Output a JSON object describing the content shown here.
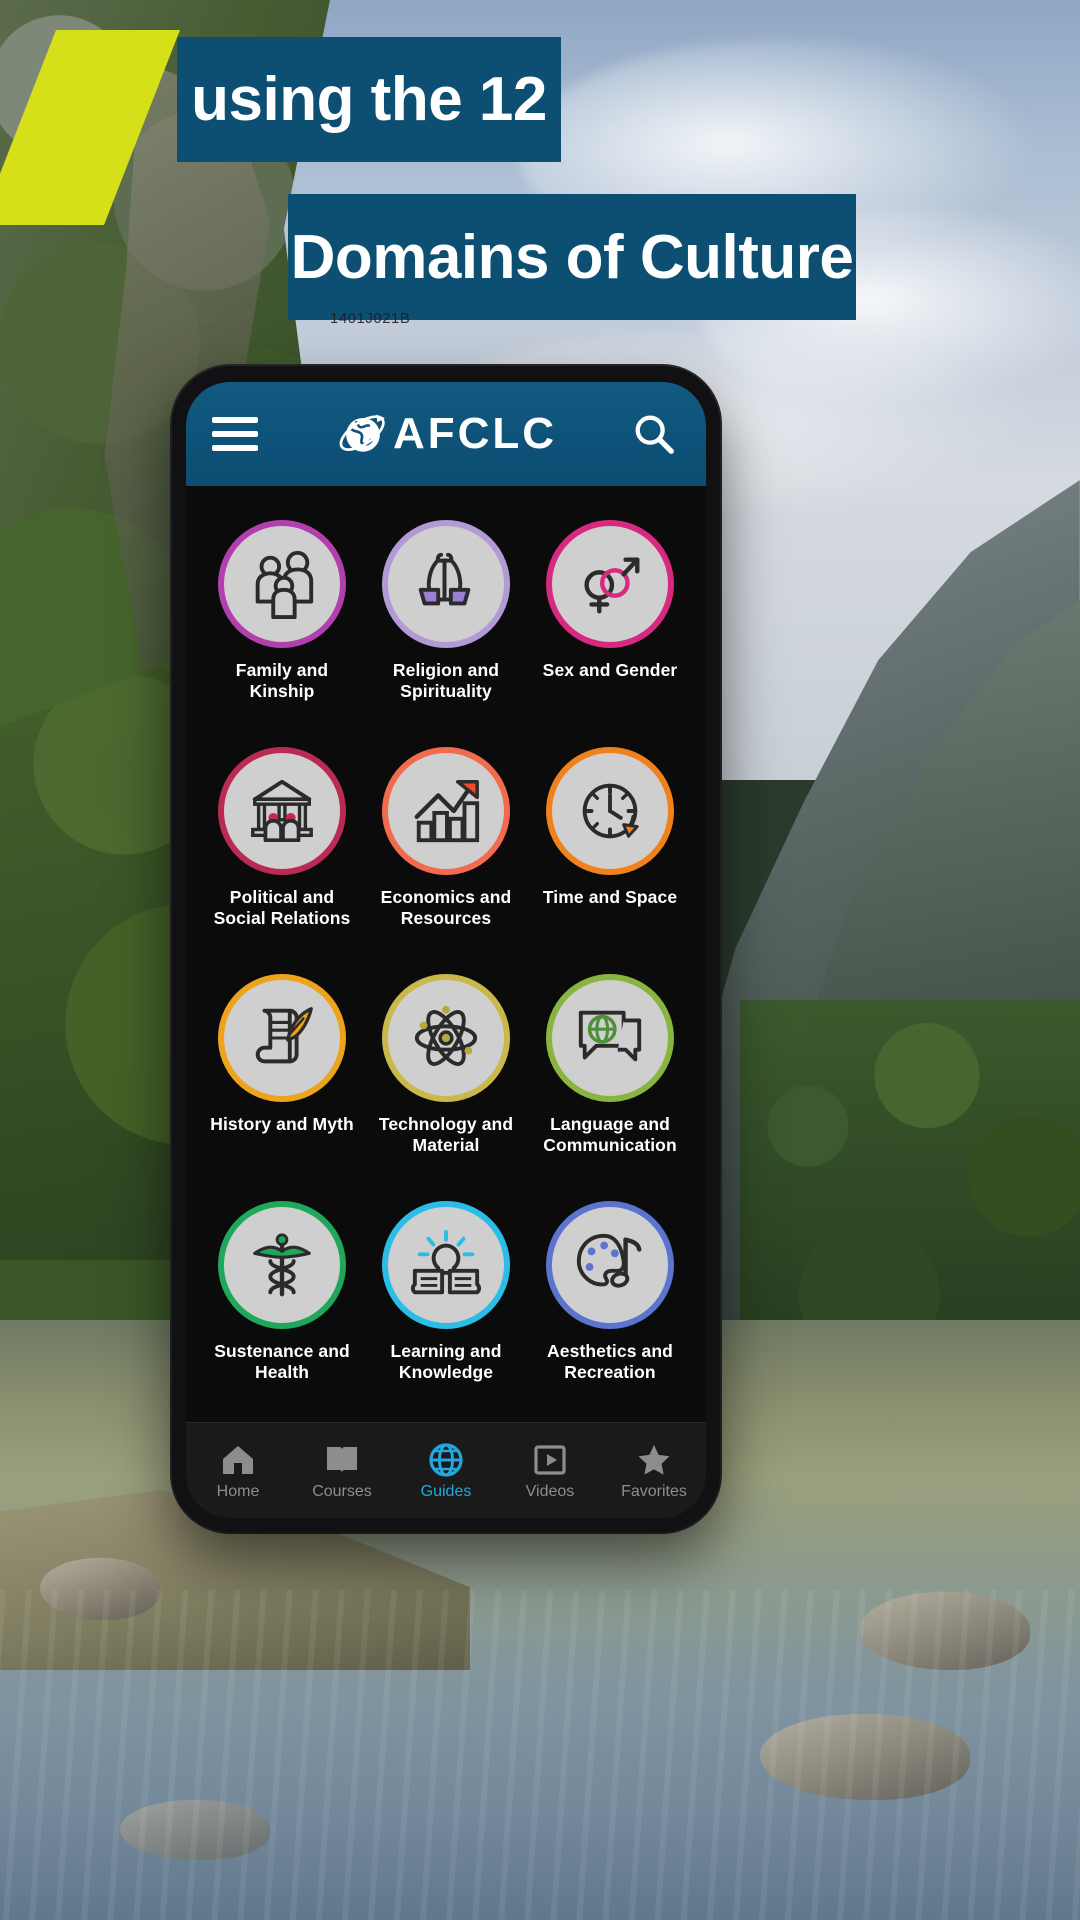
{
  "poster": {
    "headline_line1": "using the 12",
    "headline_line2": "Domains of Culture",
    "watermark": "1401J021B",
    "colors": {
      "banner_blue": "#0d4f73",
      "accent_yellow": "#d6e018",
      "active_tab": "#23a7dd"
    }
  },
  "app": {
    "header": {
      "menu_icon": "hamburger-menu-icon",
      "brand": "AFCLC",
      "brand_globe_icon": "globe-orbit-icon",
      "search_icon": "search-icon"
    },
    "domains": [
      {
        "label": "Family and Kinship",
        "icon": "family-group-icon",
        "ring": "#b23fae",
        "accent": "#b23fae"
      },
      {
        "label": "Religion and Spirituality",
        "icon": "praying-hands-icon",
        "ring": "#b39ad6",
        "accent": "#9b7fd4"
      },
      {
        "label": "Sex and Gender",
        "icon": "gender-symbols-icon",
        "ring": "#d6297f",
        "accent": "#d6297f"
      },
      {
        "label": "Political and Social Relations",
        "icon": "government-building-icon",
        "ring": "#b92b52",
        "accent": "#c32a4d"
      },
      {
        "label": "Economics and Resources",
        "icon": "growth-chart-icon",
        "ring": "#f26b4e",
        "accent": "#f04a2a"
      },
      {
        "label": "Time and Space",
        "icon": "clock-compass-icon",
        "ring": "#f0821e",
        "accent": "#f0821e"
      },
      {
        "label": "History and Myth",
        "icon": "scroll-quill-icon",
        "ring": "#eda31c",
        "accent": "#eda31c"
      },
      {
        "label": "Technology and Material",
        "icon": "atom-icon",
        "ring": "#cbb84a",
        "accent": "#b9a63c"
      },
      {
        "label": "Language and Communication",
        "icon": "speech-globe-icon",
        "ring": "#87b53f",
        "accent": "#4e8f3a"
      },
      {
        "label": "Sustenance and Health",
        "icon": "caduceus-icon",
        "ring": "#1fa85c",
        "accent": "#1fa85c"
      },
      {
        "label": "Learning and Knowledge",
        "icon": "lightbulb-book-icon",
        "ring": "#2bbde8",
        "accent": "#2bbde8"
      },
      {
        "label": "Aesthetics and Recreation",
        "icon": "palette-music-icon",
        "ring": "#5b74cf",
        "accent": "#5b74cf"
      }
    ],
    "bottom_nav": [
      {
        "label": "Home",
        "icon": "home-icon",
        "active": false
      },
      {
        "label": "Courses",
        "icon": "book-icon",
        "active": false
      },
      {
        "label": "Guides",
        "icon": "globe-icon",
        "active": true
      },
      {
        "label": "Videos",
        "icon": "video-play-icon",
        "active": false
      },
      {
        "label": "Favorites",
        "icon": "star-icon",
        "active": false
      }
    ]
  }
}
